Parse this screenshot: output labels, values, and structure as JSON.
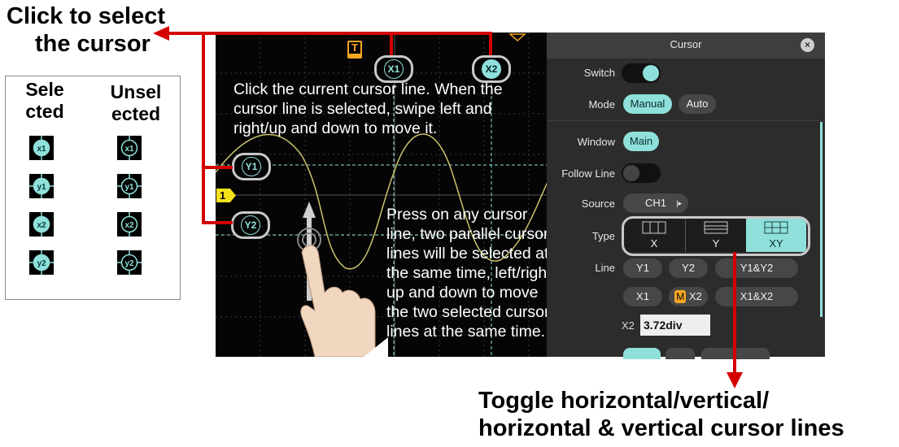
{
  "callouts": {
    "top_left_line1": "Click to select",
    "top_left_line2": "the cursor",
    "bottom_line1": "Toggle horizontal/vertical/",
    "bottom_line2": "horizontal & vertical cursor lines"
  },
  "legend": {
    "selected_line1": "Sele",
    "selected_line2": "cted",
    "unselected_line1": "Unsel",
    "unselected_line2": "ected",
    "icons": [
      "x1",
      "y1",
      "x2",
      "y2"
    ]
  },
  "scope": {
    "instruction_1": [
      "Click the current cursor line. When the",
      "cursor line is selected, swipe left and",
      "right/up and down to move it."
    ],
    "instruction_2": [
      "Press on any cursor",
      "line, two parallel cursor",
      "lines will be selected at",
      "the same time, left/right/",
      "up and down to move",
      "the two selected cursor",
      "lines at the same time."
    ],
    "trigger_marker": "T",
    "channel_marker": "1",
    "cursor_labels": {
      "x1": "X1",
      "x2": "X2",
      "y1": "Y1",
      "y2": "Y2"
    },
    "wave_color": "#c9c26a",
    "cursor_color": "#8fe0da"
  },
  "panel": {
    "title": "Cursor",
    "switch_label": "Switch",
    "mode_label": "Mode",
    "mode_manual": "Manual",
    "mode_auto": "Auto",
    "window_label": "Window",
    "window_main": "Main",
    "follow_label": "Follow Line",
    "source_label": "Source",
    "source_value": "CH1",
    "type_label": "Type",
    "type_x": "X",
    "type_y": "Y",
    "type_xy": "XY",
    "line_label": "Line",
    "line_y1": "Y1",
    "line_y2": "Y2",
    "line_y1y2": "Y1&Y2",
    "line_x1": "X1",
    "line_m": "M",
    "line_x2": "X2",
    "line_x1x2": "X1&X2",
    "x2_label": "X2",
    "x2_value": "3.72div"
  },
  "colors": {
    "accent": "#8fe0da",
    "annotation_red": "#d40000",
    "marker_orange": "#f5a623"
  }
}
